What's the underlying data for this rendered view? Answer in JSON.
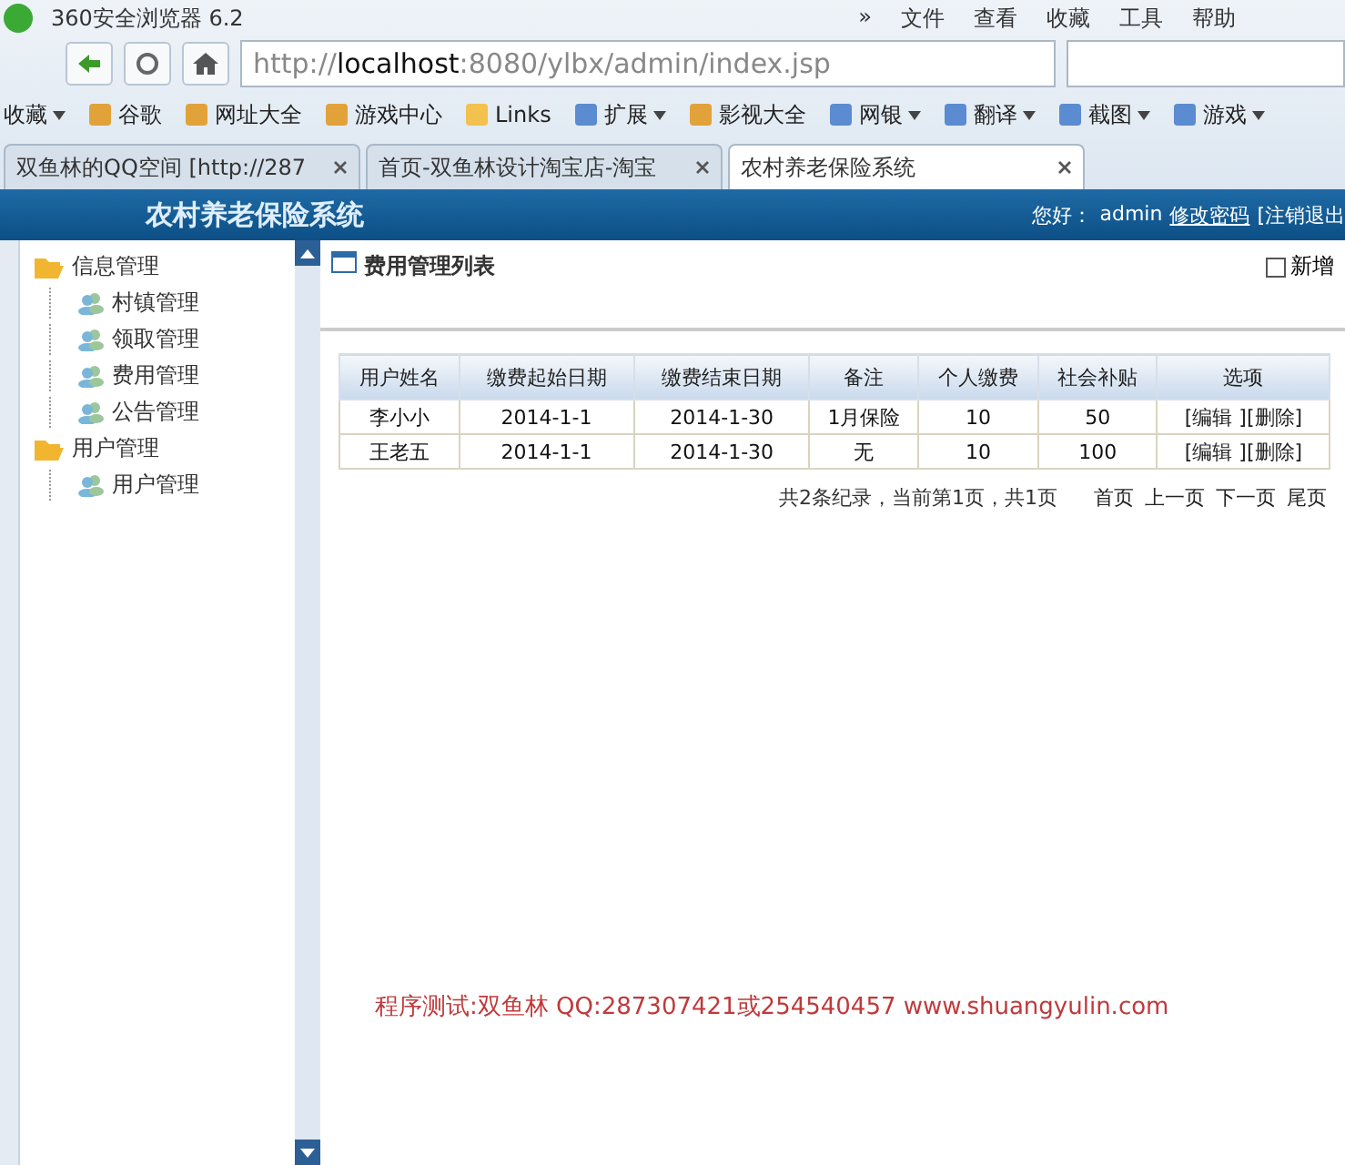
{
  "browser": {
    "title": "360安全浏览器 6.2",
    "menu": [
      "»",
      "文件",
      "查看",
      "收藏",
      "工具",
      "帮助"
    ],
    "url": {
      "host": "localhost",
      "rest": ":8080/ylbx/admin/index.jsp",
      "scheme": "http://"
    },
    "bookmarks": [
      {
        "label": "收藏",
        "kind": "menu"
      },
      {
        "label": "谷歌",
        "kind": "link"
      },
      {
        "label": "网址大全",
        "kind": "link"
      },
      {
        "label": "游戏中心",
        "kind": "link"
      },
      {
        "label": "Links",
        "kind": "folder"
      },
      {
        "label": "扩展",
        "kind": "menu"
      },
      {
        "label": "影视大全",
        "kind": "link"
      },
      {
        "label": "网银",
        "kind": "menu"
      },
      {
        "label": "翻译",
        "kind": "menu"
      },
      {
        "label": "截图",
        "kind": "menu"
      },
      {
        "label": "游戏",
        "kind": "menu"
      }
    ],
    "tabs": [
      {
        "label": "双鱼林的QQ空间 [http://287",
        "selected": false
      },
      {
        "label": "首页-双鱼林设计淘宝店-淘宝",
        "selected": false
      },
      {
        "label": "农村养老保险系统",
        "selected": true
      }
    ]
  },
  "app": {
    "title": "农村养老保险系统",
    "greeting": "您好：",
    "user": "admin",
    "change_password": "修改密码",
    "logout": "[注销退出"
  },
  "sidebar": [
    {
      "label": "信息管理",
      "expanded": true,
      "children": [
        {
          "label": "村镇管理"
        },
        {
          "label": "领取管理"
        },
        {
          "label": "费用管理"
        },
        {
          "label": "公告管理"
        }
      ]
    },
    {
      "label": "用户管理",
      "expanded": true,
      "children": [
        {
          "label": "用户管理"
        }
      ]
    }
  ],
  "content": {
    "title": "费用管理列表",
    "add": "新增",
    "table": {
      "columns": [
        "用户姓名",
        "缴费起始日期",
        "缴费结束日期",
        "备注",
        "个人缴费",
        "社会补贴",
        "选项"
      ],
      "rows": [
        {
          "cells": [
            "李小小",
            "2014-1-1",
            "2014-1-30",
            "1月保险",
            "10",
            "50"
          ],
          "actions": [
            "[编辑 ]",
            "[删除]"
          ]
        },
        {
          "cells": [
            "王老五",
            "2014-1-1",
            "2014-1-30",
            "无",
            "10",
            "100"
          ],
          "actions": [
            "[编辑 ]",
            "[删除]"
          ]
        }
      ]
    },
    "pager": {
      "summary": "共2条纪录，当前第1页，共1页",
      "links": [
        "首页",
        "上一页",
        "下一页",
        "尾页"
      ]
    },
    "footer": "程序测试:双鱼林 QQ:287307421或254540457 www.shuangyulin.com"
  }
}
